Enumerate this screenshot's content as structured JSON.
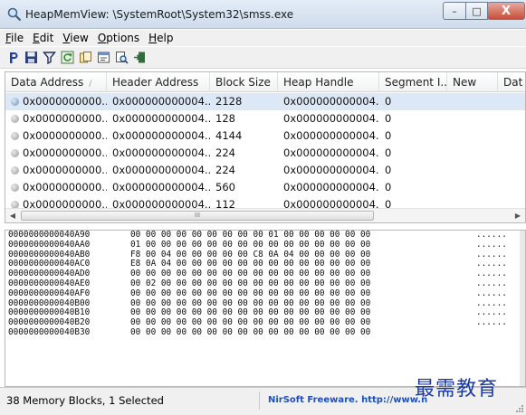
{
  "window": {
    "title": "HeapMemView:  \\SystemRoot\\System32\\smss.exe",
    "buttons": {
      "minimize": "–",
      "maximize": "□",
      "close": "X"
    }
  },
  "menu": [
    {
      "underline": "F",
      "rest": "ile"
    },
    {
      "underline": "E",
      "rest": "dit"
    },
    {
      "underline": "V",
      "rest": "iew"
    },
    {
      "underline": "O",
      "rest": "ptions"
    },
    {
      "underline": "H",
      "rest": "elp"
    }
  ],
  "toolbar_icons": [
    "properties-p-icon",
    "save-icon",
    "filter-icon",
    "refresh-icon",
    "copy-icon",
    "properties-icon",
    "find-icon",
    "exit-icon"
  ],
  "table": {
    "columns": [
      "Data Address",
      "Header Address",
      "Block Size",
      "Heap Handle",
      "Segment I...",
      "New",
      "Dat"
    ],
    "sort_arrow": "/",
    "rows": [
      {
        "data": "0x0000000000...",
        "header": "0x000000000004...",
        "size": "2128",
        "heap": "0x000000000004...",
        "segment": "0",
        "selected": true
      },
      {
        "data": "0x0000000000...",
        "header": "0x000000000004...",
        "size": "128",
        "heap": "0x000000000004...",
        "segment": "0",
        "selected": false
      },
      {
        "data": "0x0000000000...",
        "header": "0x000000000004...",
        "size": "4144",
        "heap": "0x000000000004...",
        "segment": "0",
        "selected": false
      },
      {
        "data": "0x0000000000...",
        "header": "0x000000000004...",
        "size": "224",
        "heap": "0x000000000004...",
        "segment": "0",
        "selected": false
      },
      {
        "data": "0x0000000000...",
        "header": "0x000000000004...",
        "size": "224",
        "heap": "0x000000000004...",
        "segment": "0",
        "selected": false
      },
      {
        "data": "0x0000000000...",
        "header": "0x000000000004...",
        "size": "560",
        "heap": "0x000000000004...",
        "segment": "0",
        "selected": false
      },
      {
        "data": "0x0000000000...",
        "header": "0x000000000004...",
        "size": "112",
        "heap": "0x000000000004...",
        "segment": "0",
        "selected": false
      }
    ],
    "scroll_thumb_label": "III"
  },
  "hex": [
    {
      "addr": "0000000000040A90",
      "bytes": "00 00 00 00 00 00 00 00 00 01 00 00 00 00 00 00",
      "ascii": "......"
    },
    {
      "addr": "0000000000040AA0",
      "bytes": "01 00 00 00 00 00 00 00 00 00 00 00 00 00 00 00",
      "ascii": "......"
    },
    {
      "addr": "0000000000040AB0",
      "bytes": "F8 00 04 00 00 00 00 00 C8 0A 04 00 00 00 00 00",
      "ascii": "......"
    },
    {
      "addr": "0000000000040AC0",
      "bytes": "E8 0A 04 00 00 00 00 00 00 00 00 00 00 00 00 00",
      "ascii": "......"
    },
    {
      "addr": "0000000000040AD0",
      "bytes": "00 00 00 00 00 00 00 00 00 00 00 00 00 00 00 00",
      "ascii": "......"
    },
    {
      "addr": "0000000000040AE0",
      "bytes": "00 02 00 00 00 00 00 00 00 00 00 00 00 00 00 00",
      "ascii": "......"
    },
    {
      "addr": "0000000000040AF0",
      "bytes": "00 00 00 00 00 00 00 00 00 00 00 00 00 00 00 00",
      "ascii": "......"
    },
    {
      "addr": "0000000000040B00",
      "bytes": "00 00 00 00 00 00 00 00 00 00 00 00 00 00 00 00",
      "ascii": "......"
    },
    {
      "addr": "0000000000040B10",
      "bytes": "00 00 00 00 00 00 00 00 00 00 00 00 00 00 00 00",
      "ascii": "......"
    },
    {
      "addr": "0000000000040B20",
      "bytes": "00 00 00 00 00 00 00 00 00 00 00 00 00 00 00 00",
      "ascii": "......"
    },
    {
      "addr": "0000000000040B30",
      "bytes": "00 00 00 00 00 00 00 00 00 00 00 00 00 00 00 00",
      "ascii": ""
    }
  ],
  "status": {
    "blocks_text": "38 Memory Blocks, 1 Selected",
    "link_text": "NirSoft Freeware.  http://www.n"
  },
  "watermark": "最需教育",
  "colors": {
    "selection": "#dde8f6",
    "link": "#1f4fb8",
    "watermark": "#1c3aa3"
  }
}
